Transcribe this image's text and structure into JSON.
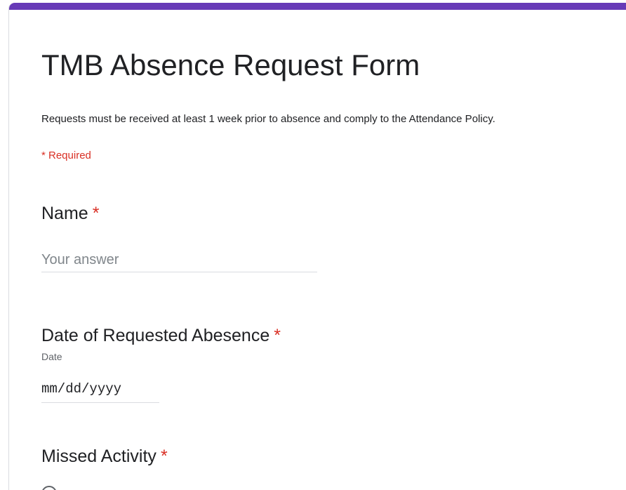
{
  "form": {
    "title": "TMB Absence Request Form",
    "description": "Requests must be received at least 1 week prior to absence and comply to the Attendance Policy.",
    "required_note": "* Required",
    "accent_color": "#673ab7",
    "required_color": "#d93025"
  },
  "questions": {
    "name": {
      "label": "Name",
      "required_mark": "*",
      "placeholder": "Your answer",
      "value": ""
    },
    "date": {
      "label": "Date of Requested Abesence",
      "required_mark": "*",
      "sublabel": "Date",
      "value": "mm/dd/yyyy"
    },
    "missed_activity": {
      "label": "Missed Activity",
      "required_mark": "*",
      "options": [
        {
          "label": "",
          "selected": false
        }
      ]
    }
  }
}
